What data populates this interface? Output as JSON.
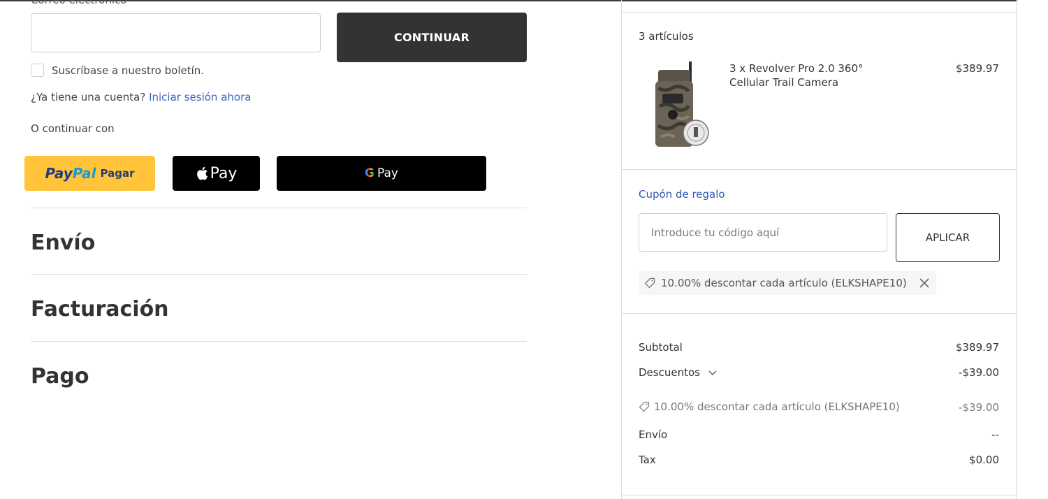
{
  "contact": {
    "email_label": "Correo electrónico",
    "email_value": "",
    "continue_label": "CONTINUAR",
    "newsletter_label": "Suscríbase a nuestro boletín.",
    "account_question": "¿Ya tiene una cuenta?",
    "signin_link": "Iniciar sesión ahora",
    "continue_with": "O continuar con"
  },
  "payment_buttons": {
    "paypal_logo_pay": "Pay",
    "paypal_logo_pal": "Pal",
    "paypal_text": "Pagar",
    "applepay_text": "Pay",
    "gpay_g": "G",
    "gpay_text": "Pay"
  },
  "sections": {
    "shipping": "Envío",
    "billing": "Facturación",
    "payment": "Pago"
  },
  "summary": {
    "items_count": "3 artículos",
    "product": {
      "name": "3 x Revolver Pro 2.0 360° Cellular Trail Camera",
      "price": "$389.97"
    },
    "coupon_label": "Cupón de regalo",
    "coupon_placeholder": "Introduce tu código aquí",
    "apply_label": "APLICAR",
    "applied_coupon": "10.00% descontar cada artículo (ELKSHAPE10)",
    "subtotal_label": "Subtotal",
    "subtotal_value": "$389.97",
    "discounts_label": "Descuentos",
    "discounts_value": "-$39.00",
    "discount_detail_label": "10.00% descontar cada artículo (ELKSHAPE10)",
    "discount_detail_value": "-$39.00",
    "shipping_label": "Envío",
    "shipping_value": "--",
    "tax_label": "Tax",
    "tax_value": "$0.00"
  },
  "colors": {
    "continue_bg": "#333333",
    "link": "#3a63c4",
    "coupon_link": "#2f58b0",
    "paypal_bg": "#ffc439"
  }
}
